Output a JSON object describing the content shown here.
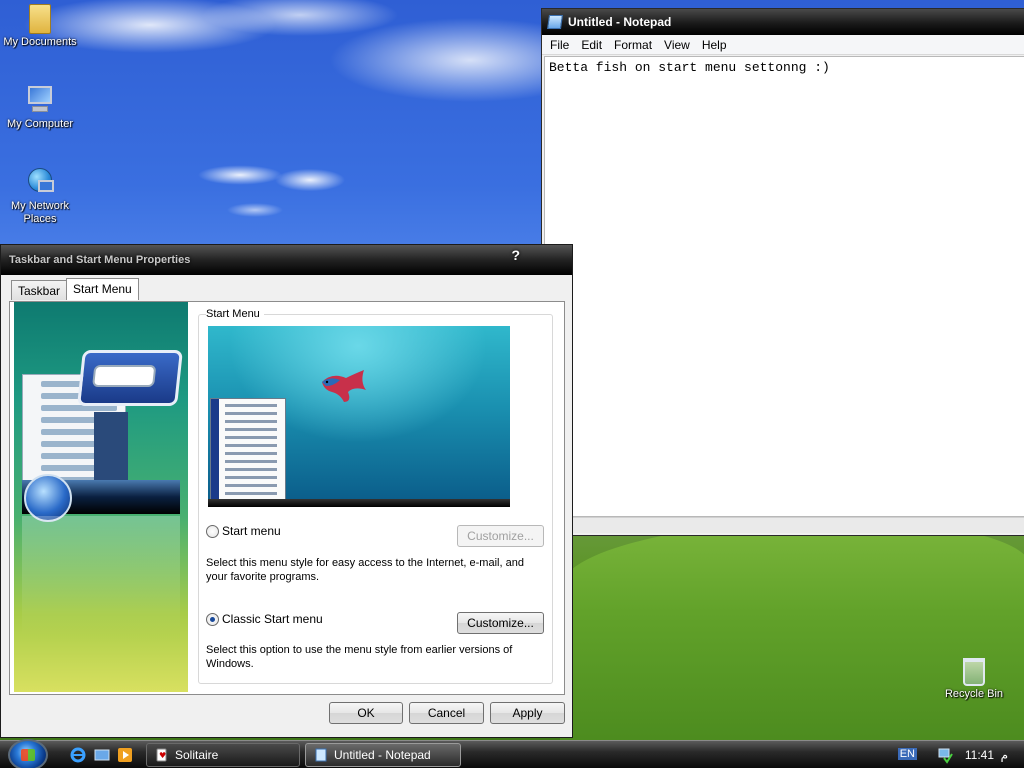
{
  "desktop": {
    "icons": [
      {
        "label": "My Documents",
        "icon": "folder-icon"
      },
      {
        "label": "My Computer",
        "icon": "computer-icon"
      },
      {
        "label": "My Network Places",
        "icon": "network-places-icon"
      },
      {
        "label": "Recycle Bin",
        "icon": "recycle-bin-icon"
      }
    ]
  },
  "notepad": {
    "title": "Untitled - Notepad",
    "menu": [
      "File",
      "Edit",
      "Format",
      "View",
      "Help"
    ],
    "content": "Betta fish on start menu settonng :)"
  },
  "dialog": {
    "title": "Taskbar and Start Menu Properties",
    "help": "?",
    "tabs": [
      {
        "label": "Taskbar",
        "active": false
      },
      {
        "label": "Start Menu",
        "active": true
      }
    ],
    "group_label": "Start Menu",
    "options": [
      {
        "label": "Start menu",
        "checked": false,
        "description": "Select this menu style for easy access to the Internet, e-mail, and your favorite programs.",
        "customize_label": "Customize...",
        "customize_enabled": false
      },
      {
        "label": "Classic Start menu",
        "checked": true,
        "description": "Select this option to use the menu style from earlier versions of Windows.",
        "customize_label": "Customize...",
        "customize_enabled": true
      }
    ],
    "buttons": {
      "ok": "OK",
      "cancel": "Cancel",
      "apply": "Apply"
    }
  },
  "taskbar": {
    "quick_launch": [
      "internet-explorer-icon",
      "show-desktop-icon",
      "media-player-icon"
    ],
    "tasks": [
      {
        "label": "Solitaire",
        "active": false
      },
      {
        "label": "Untitled - Notepad",
        "active": true
      }
    ],
    "tray": {
      "language": "EN",
      "time": "11:41",
      "am_pm": "م"
    }
  },
  "colors": {
    "titlebar": "#1a1a1a",
    "taskbar": "#0a0a0a",
    "sky": "#3a6fe0",
    "grass": "#5f962c"
  }
}
